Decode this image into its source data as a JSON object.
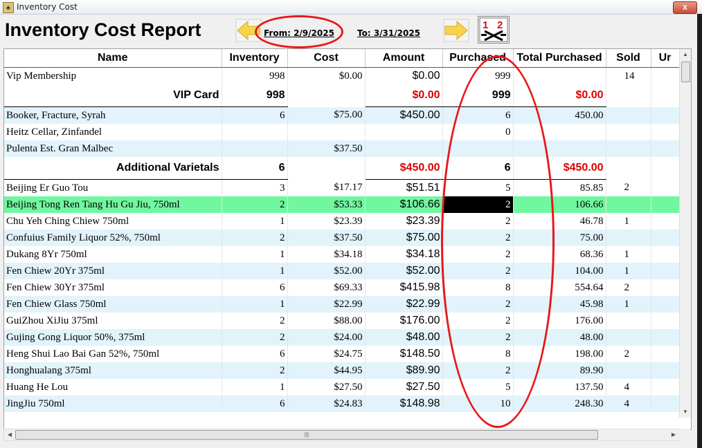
{
  "window": {
    "title": "Inventory Cost",
    "close_label": "x"
  },
  "header": {
    "report_title": "Inventory Cost Report",
    "from_label": "From: 2/9/2025",
    "to_label": "To: 3/31/2025",
    "calc_label": "1 2"
  },
  "columns": [
    "Name",
    "Inventory",
    "Cost",
    "Amount",
    "Purchased",
    "Total Purchased",
    "Sold",
    "Ur"
  ],
  "rows": [
    {
      "type": "item",
      "name": "Vip Membership",
      "inventory": "998",
      "cost": "$0.00",
      "amount": "$0.00",
      "purchased": "999",
      "total": "",
      "sold": "14",
      "style": ""
    },
    {
      "type": "subtotal",
      "name": "VIP Card",
      "inventory": "998",
      "amount": "$0.00",
      "purchased": "999",
      "total": "$0.00"
    },
    {
      "type": "item",
      "name": "Booker, Fracture, Syrah",
      "inventory": "6",
      "cost": "$75.00",
      "amount": "$450.00",
      "purchased": "6",
      "total": "450.00",
      "sold": "",
      "style": "alt"
    },
    {
      "type": "item",
      "name": "Heitz Cellar, Zinfandel",
      "inventory": "",
      "cost": "",
      "amount": "",
      "purchased": "0",
      "total": "",
      "sold": "",
      "style": ""
    },
    {
      "type": "item",
      "name": "Pulenta Est. Gran Malbec",
      "inventory": "",
      "cost": "$37.50",
      "amount": "",
      "purchased": "",
      "total": "",
      "sold": "",
      "style": "alt"
    },
    {
      "type": "subtotal",
      "name": "Additional Varietals",
      "inventory": "6",
      "amount": "$450.00",
      "purchased": "6",
      "total": "$450.00"
    },
    {
      "type": "item",
      "name": "Beijing Er Guo Tou",
      "inventory": "3",
      "cost": "$17.17",
      "amount": "$51.51",
      "purchased": "5",
      "total": "85.85",
      "sold": "2",
      "style": ""
    },
    {
      "type": "item",
      "name": "Beijing Tong Ren Tang Hu Gu Jiu, 750ml",
      "inventory": "2",
      "cost": "$53.33",
      "amount": "$106.66",
      "purchased": "2",
      "total": "106.66",
      "sold": "",
      "style": "selected"
    },
    {
      "type": "item",
      "name": "Chu Yeh Ching Chiew 750ml",
      "inventory": "1",
      "cost": "$23.39",
      "amount": "$23.39",
      "purchased": "2",
      "total": "46.78",
      "sold": "1",
      "style": ""
    },
    {
      "type": "item",
      "name": "Confuius Family Liquor 52%, 750ml",
      "inventory": "2",
      "cost": "$37.50",
      "amount": "$75.00",
      "purchased": "2",
      "total": "75.00",
      "sold": "",
      "style": "alt"
    },
    {
      "type": "item",
      "name": "Dukang 8Yr 750ml",
      "inventory": "1",
      "cost": "$34.18",
      "amount": "$34.18",
      "purchased": "2",
      "total": "68.36",
      "sold": "1",
      "style": ""
    },
    {
      "type": "item",
      "name": "Fen Chiew 20Yr 375ml",
      "inventory": "1",
      "cost": "$52.00",
      "amount": "$52.00",
      "purchased": "2",
      "total": "104.00",
      "sold": "1",
      "style": "alt"
    },
    {
      "type": "item",
      "name": "Fen Chiew 30Yr 375ml",
      "inventory": "6",
      "cost": "$69.33",
      "amount": "$415.98",
      "purchased": "8",
      "total": "554.64",
      "sold": "2",
      "style": ""
    },
    {
      "type": "item",
      "name": "Fen Chiew Glass 750ml",
      "inventory": "1",
      "cost": "$22.99",
      "amount": "$22.99",
      "purchased": "2",
      "total": "45.98",
      "sold": "1",
      "style": "alt"
    },
    {
      "type": "item",
      "name": "GuiZhou XiJiu 375ml",
      "inventory": "2",
      "cost": "$88.00",
      "amount": "$176.00",
      "purchased": "2",
      "total": "176.00",
      "sold": "",
      "style": ""
    },
    {
      "type": "item",
      "name": "Gujing Gong Liquor 50%, 375ml",
      "inventory": "2",
      "cost": "$24.00",
      "amount": "$48.00",
      "purchased": "2",
      "total": "48.00",
      "sold": "",
      "style": "alt"
    },
    {
      "type": "item",
      "name": "Heng Shui Lao Bai Gan 52%, 750ml",
      "inventory": "6",
      "cost": "$24.75",
      "amount": "$148.50",
      "purchased": "8",
      "total": "198.00",
      "sold": "2",
      "style": ""
    },
    {
      "type": "item",
      "name": "Honghualang 375ml",
      "inventory": "2",
      "cost": "$44.95",
      "amount": "$89.90",
      "purchased": "2",
      "total": "89.90",
      "sold": "",
      "style": "alt"
    },
    {
      "type": "item",
      "name": "Huang He Lou",
      "inventory": "1",
      "cost": "$27.50",
      "amount": "$27.50",
      "purchased": "5",
      "total": "137.50",
      "sold": "4",
      "style": ""
    },
    {
      "type": "item",
      "name": "JingJiu 750ml",
      "inventory": "6",
      "cost": "$24.83",
      "amount": "$148.98",
      "purchased": "10",
      "total": "248.30",
      "sold": "4",
      "style": "alt"
    }
  ],
  "colors": {
    "highlight": "#70f7a0",
    "alt_row": "#e2f3fb",
    "subtotal_red": "#e00000",
    "annotation": "#e8171a"
  }
}
